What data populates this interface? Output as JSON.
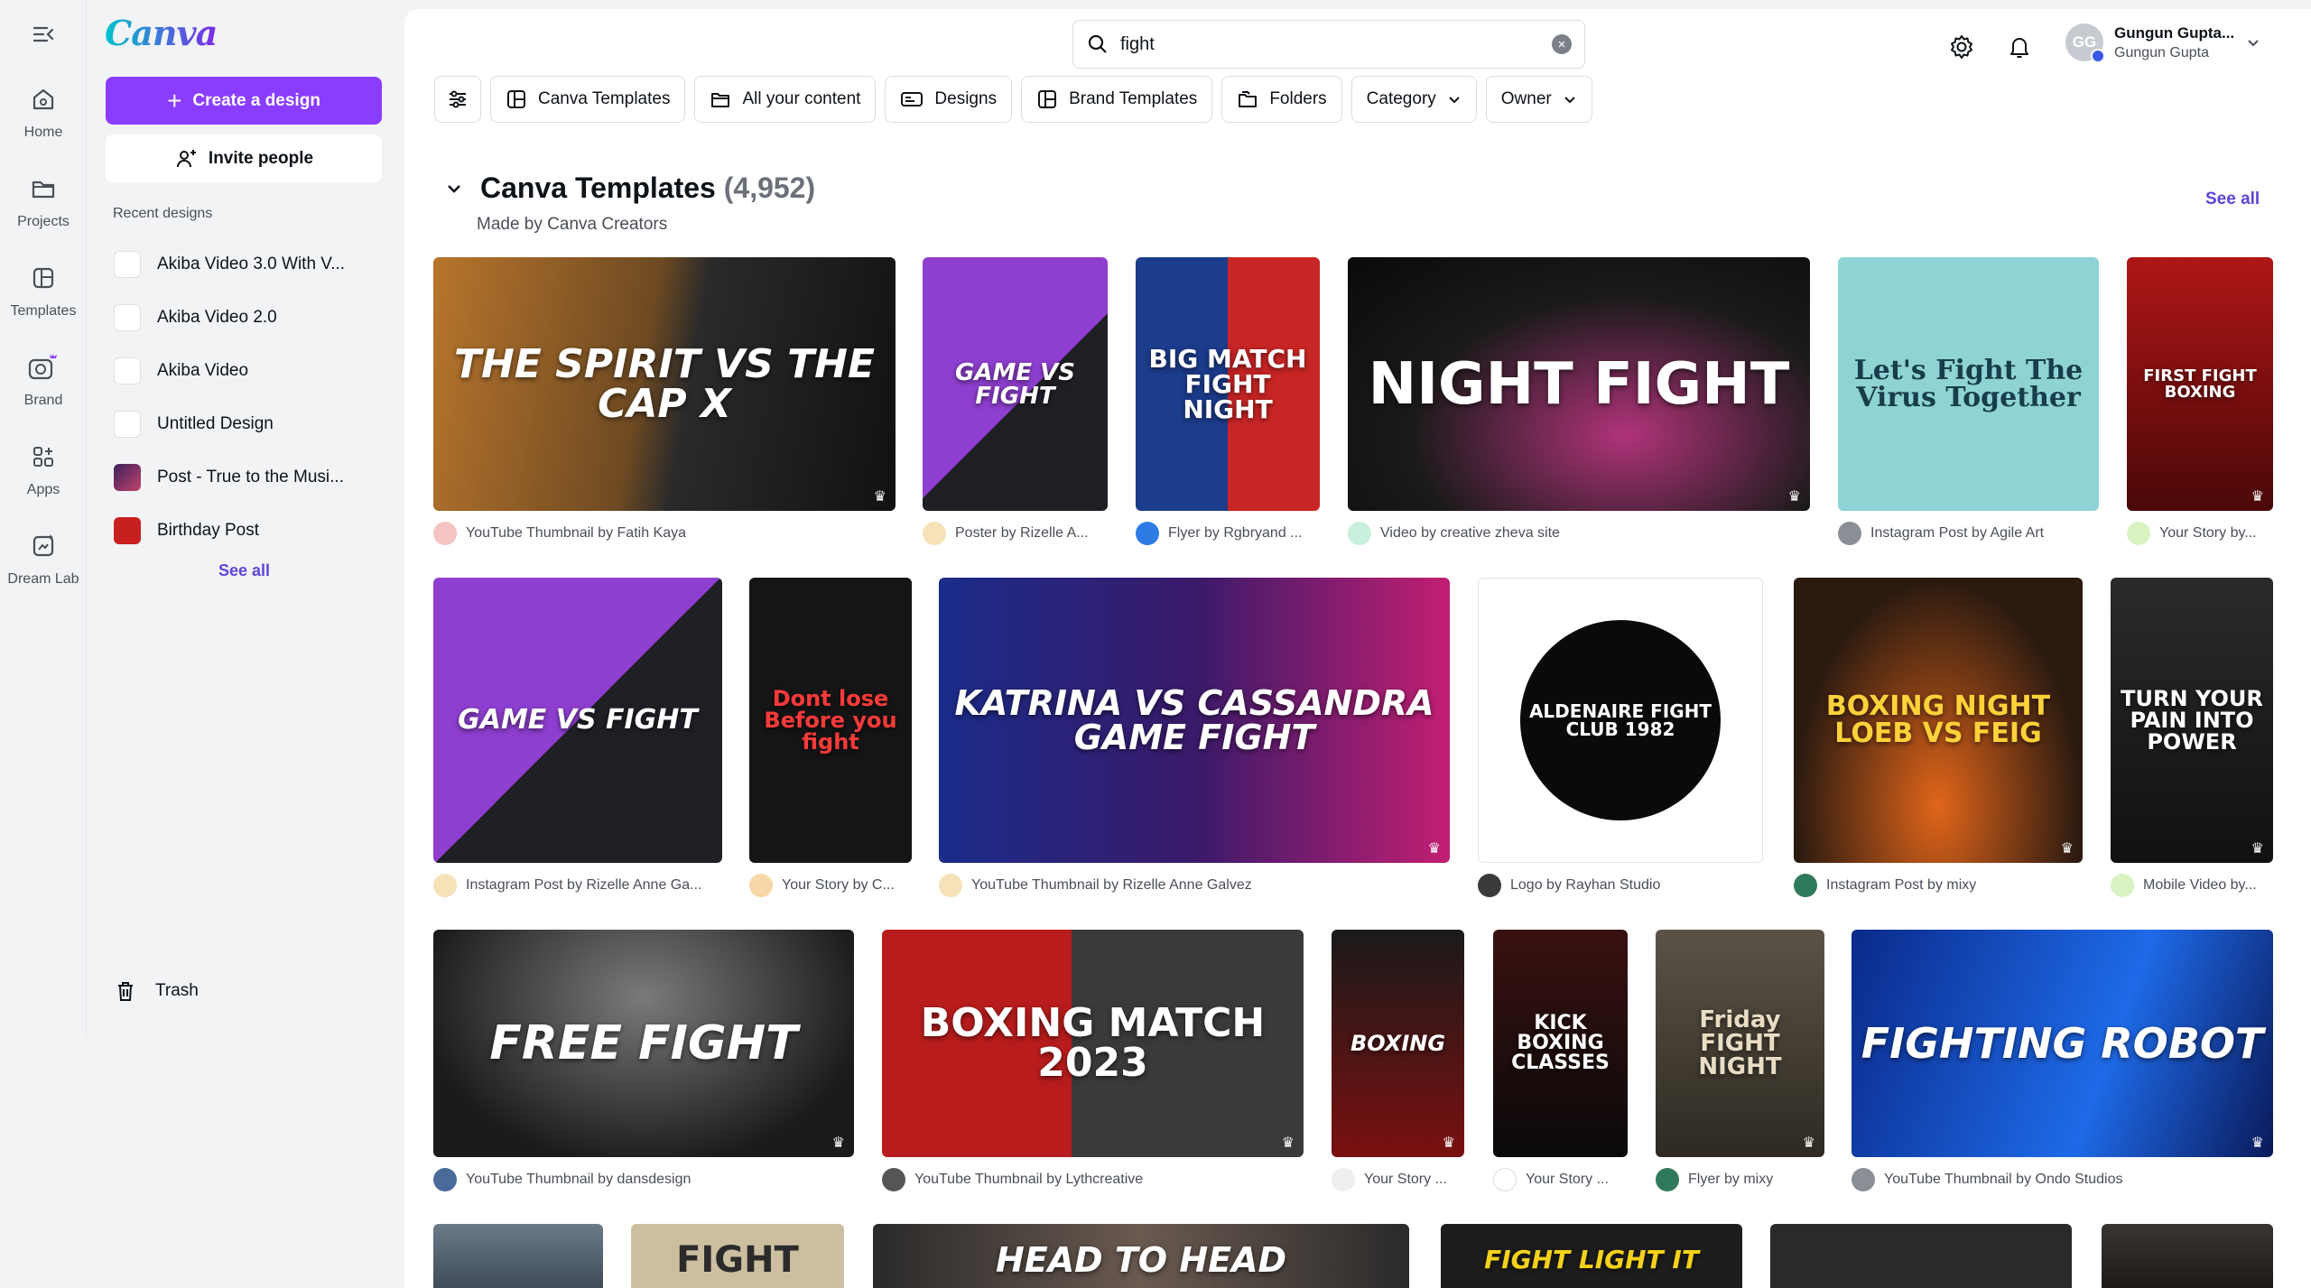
{
  "rail": {
    "items": [
      {
        "label": "Home"
      },
      {
        "label": "Projects"
      },
      {
        "label": "Templates"
      },
      {
        "label": "Brand"
      },
      {
        "label": "Apps"
      },
      {
        "label": "Dream Lab"
      }
    ]
  },
  "panel": {
    "logo": "Canva",
    "create_label": "Create a design",
    "invite_label": "Invite people",
    "recent_heading": "Recent designs",
    "recent": [
      {
        "title": "Akiba Video 3.0 With V..."
      },
      {
        "title": "Akiba Video 2.0"
      },
      {
        "title": "Akiba Video"
      },
      {
        "title": "Untitled Design"
      },
      {
        "title": "Post - True to the Musi..."
      },
      {
        "title": "Birthday Post"
      }
    ],
    "see_all": "See all",
    "trash": "Trash"
  },
  "search": {
    "value": "fight"
  },
  "user": {
    "initials": "GG",
    "name": "Gungun Gupta...",
    "team": "Gungun Gupta"
  },
  "filters": [
    {
      "label": "Canva Templates"
    },
    {
      "label": "All your content"
    },
    {
      "label": "Designs"
    },
    {
      "label": "Brand Templates"
    },
    {
      "label": "Folders"
    },
    {
      "label": "Category"
    },
    {
      "label": "Owner"
    }
  ],
  "section": {
    "title": "Canva Templates",
    "count": "(4,952)",
    "subtitle": "Made by Canva Creators",
    "see_all": "See all"
  },
  "templates": [
    {
      "caption": "YouTube Thumbnail by Fatih Kaya",
      "art": "THE SPIRIT VS THE CAP X"
    },
    {
      "caption": "Poster by Rizelle A...",
      "art": "GAME VS FIGHT"
    },
    {
      "caption": "Flyer by Rgbryand ...",
      "art": "BIG MATCH FIGHT NIGHT"
    },
    {
      "caption": "Video by creative zheva site",
      "art": "NIGHT FIGHT"
    },
    {
      "caption": "Instagram Post by Agile Art",
      "art": "Let's Fight The Virus Together"
    },
    {
      "caption": "Your Story by...",
      "art": "FIRST FIGHT BOXING"
    },
    {
      "caption": "Instagram Post by Rizelle Anne Ga...",
      "art": "GAME VS FIGHT"
    },
    {
      "caption": "Your Story by C...",
      "art": "Dont lose Before you fight"
    },
    {
      "caption": "YouTube Thumbnail by Rizelle Anne Galvez",
      "art": "KATRINA VS CASSANDRA GAME FIGHT"
    },
    {
      "caption": "Logo by Rayhan Studio",
      "art": "ALDENAIRE FIGHT CLUB 1982"
    },
    {
      "caption": "Instagram Post by mixy",
      "art": "BOXING NIGHT LOEB VS FEIG"
    },
    {
      "caption": "Mobile Video by...",
      "art": "TURN YOUR PAIN INTO POWER"
    },
    {
      "caption": "YouTube Thumbnail by dansdesign",
      "art": "FREE FIGHT"
    },
    {
      "caption": "YouTube Thumbnail by Lythcreative",
      "art": "BOXING MATCH 2023"
    },
    {
      "caption": "Your Story ...",
      "art": "BOXING"
    },
    {
      "caption": "Your Story ...",
      "art": "KICK BOXING CLASSES"
    },
    {
      "caption": "Flyer by mixy",
      "art": "Friday FIGHT NIGHT"
    },
    {
      "caption": "YouTube Thumbnail by Ondo Studios",
      "art": "FIGHTING ROBOT"
    },
    {
      "caption": "",
      "art": ""
    },
    {
      "caption": "",
      "art": "FIGHT"
    },
    {
      "caption": "",
      "art": "HEAD TO HEAD"
    },
    {
      "caption": "",
      "art": "FIGHT LIGHT IT"
    },
    {
      "caption": "",
      "art": ""
    },
    {
      "caption": "",
      "art": ""
    }
  ],
  "colors": {
    "brand": "#8b3dff",
    "link": "#5b46d6"
  }
}
